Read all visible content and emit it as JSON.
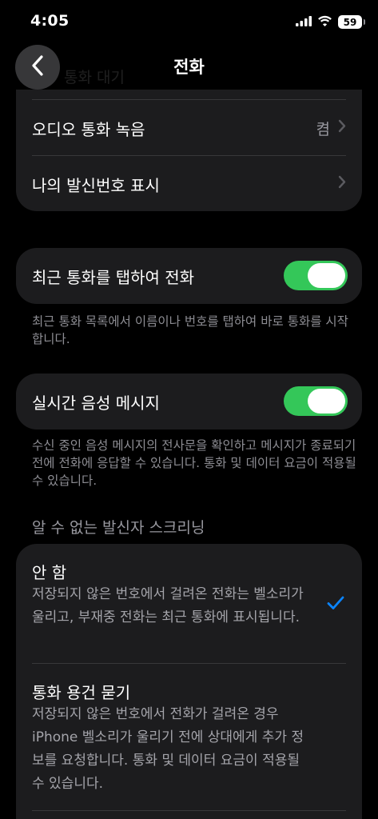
{
  "status_bar": {
    "time": "4:05",
    "battery": "59"
  },
  "nav": {
    "title": "전화",
    "scrolled_under_text": "통화 대기"
  },
  "top_group": {
    "rows": [
      {
        "label": "오디오 통화 녹음",
        "value": "켬"
      },
      {
        "label": "나의 발신번호 표시",
        "value": ""
      }
    ]
  },
  "recents_tap": {
    "label": "최근 통화를 탭하여 전화",
    "on": true,
    "footer": "최근 통화 목록에서 이름이나 번호를 탭하여 바로 통화를 시작합니다."
  },
  "live_voicemail": {
    "label": "실시간 음성 메시지",
    "on": true,
    "footer": "수신 중인 음성 메시지의 전사문을 확인하고 메시지가 종료되기 전에 전화에 응답할 수 있습니다. 통화 및 데이터 요금이 적용될 수 있습니다."
  },
  "screening": {
    "header": "알 수 없는 발신자 스크리닝",
    "options": [
      {
        "title": "안 함",
        "description": "저장되지 않은 번호에서 걸려온 전화는 벨소리가 울리고, 부재중 전화는 최근 통화에 표시됩니다.",
        "selected": true
      },
      {
        "title": "통화 용건 묻기",
        "description": "저장되지 않은 번호에서 전화가 걸려온 경우 iPhone 벨소리가 울리기 전에 상대에게 추가 정보를 요청합니다. 통화 및 데이터 요금이 적용될 수 있습니다.",
        "selected": false
      }
    ]
  },
  "colors": {
    "accent": "#0a84ff",
    "toggle_on": "#34c759",
    "cell_bg": "#1c1c1e"
  },
  "icons": {
    "back": "chevron-left-icon",
    "disclosure": "chevron-right-icon",
    "check": "checkmark-icon"
  }
}
